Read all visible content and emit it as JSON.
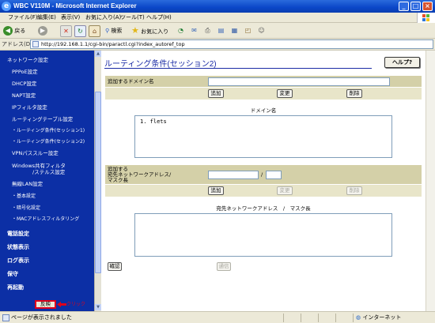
{
  "window": {
    "title": "WBC V110M - Microsoft Internet Explorer",
    "app_icon": "e",
    "controls": [
      "_",
      "□",
      "×"
    ]
  },
  "menu": {
    "items": [
      "ファイル(F)",
      "編集(E)",
      "表示(V)",
      "お気に入り(A)",
      "ツール(T)",
      "ヘルプ(H)"
    ]
  },
  "toolbar": {
    "back_label": "戻る",
    "back_symbol": "◀",
    "forward_symbol": "▶",
    "search_label": "検索",
    "favorites_label": "お気に入り"
  },
  "address": {
    "label": "アドレス(D)",
    "url": "http://192.168.1.1/cgi-bin/paractl.cgi?index_autoref_top"
  },
  "sidebar": {
    "items": [
      "ネットワーク設定",
      "PPPoE設定",
      "DHCP設定",
      "NAPT設定",
      "IPフィルタ設定",
      "ルーティングテーブル設定",
      "・ルーティング条件(セッション1)",
      "・ルーティング条件(セッション2)",
      "VPNパススルー設定",
      "Windows共有フィルタ",
      "/ステルス設定",
      "無線LAN設定",
      "・基本設定",
      "・暗号化設定",
      "・MACアドレスフィルタリング"
    ],
    "bold_items": [
      "電話設定",
      "状態表示",
      "ログ表示",
      "保守",
      "再起動"
    ],
    "apply_button": "反映",
    "arrow_text": "クリック"
  },
  "content": {
    "title": "ルーティング条件(セッション2)",
    "help_button": "ヘルプ?",
    "domain_field_label": "追加するドメイン名",
    "domain_field_value": "",
    "add_label": "追加",
    "change_label": "変更",
    "delete_label": "削除",
    "domain_list_caption": "ドメイン名",
    "domain_list": [
      "1. flets"
    ],
    "network_label_line1": "追加する",
    "network_label_line2": "宛先ネットワークアドレス/",
    "network_label_line3": "マスク長",
    "network_address_value": "",
    "slash": "/",
    "mask_value": "",
    "network_list_caption": "宛先ネットワークアドレス　/　マスク長",
    "network_list": [],
    "confirm_button": "確認",
    "send_button": "通信"
  },
  "status": {
    "text": "ページが表示されました",
    "zone": "インターネット"
  }
}
